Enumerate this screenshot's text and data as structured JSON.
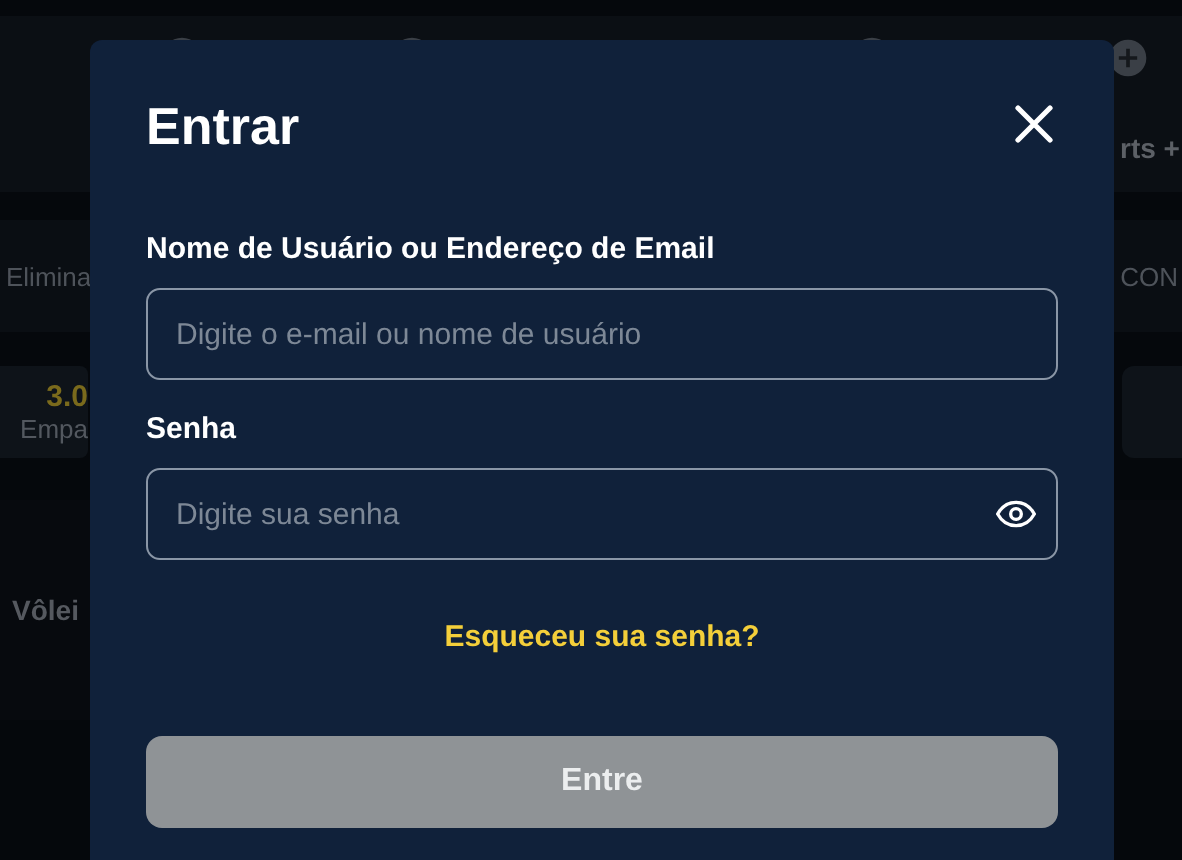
{
  "background": {
    "nav_right": "rts +",
    "row_left": "Elimina",
    "row_right": "CON",
    "odds": {
      "value": "3.0",
      "label": "Empa"
    },
    "section": "Vôlei"
  },
  "dialog": {
    "title": "Entrar",
    "fields": [
      {
        "label": "Nome de Usuário ou Endereço de Email",
        "placeholder": "Digite o e-mail ou nome de usuário",
        "kind": "text"
      },
      {
        "label": "Senha",
        "placeholder": "Digite sua senha",
        "kind": "password"
      }
    ],
    "forgot_link": "Esqueceu sua senha?",
    "submit": {
      "label": "Entre",
      "disabled": true
    }
  }
}
